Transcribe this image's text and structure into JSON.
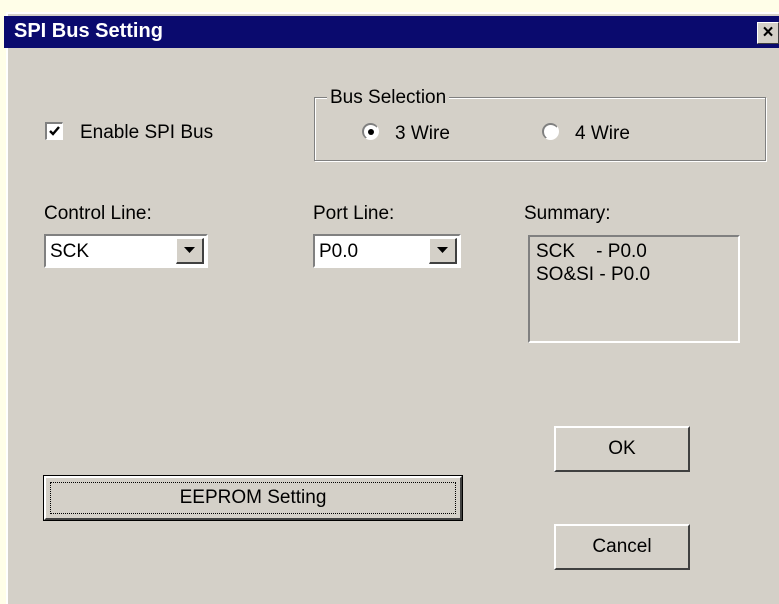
{
  "window": {
    "title": "SPI Bus Setting",
    "close_glyph": "×"
  },
  "enable": {
    "label": "Enable SPI Bus",
    "checked": true
  },
  "bus_selection": {
    "legend": "Bus Selection",
    "options": [
      {
        "label": "3 Wire",
        "selected": true
      },
      {
        "label": "4 Wire",
        "selected": false
      }
    ]
  },
  "control_line": {
    "label": "Control Line:",
    "value": "SCK"
  },
  "port_line": {
    "label": "Port Line:",
    "value": "P0.0"
  },
  "summary": {
    "label": "Summary:",
    "lines": [
      "SCK    - P0.0",
      "SO&SI - P0.0"
    ]
  },
  "buttons": {
    "ok": "OK",
    "cancel": "Cancel",
    "eeprom": "EEPROM Setting"
  },
  "colors": {
    "titlebar": "#0a0a6e",
    "face": "#d4d0c8",
    "backdrop": "#fffee8"
  }
}
